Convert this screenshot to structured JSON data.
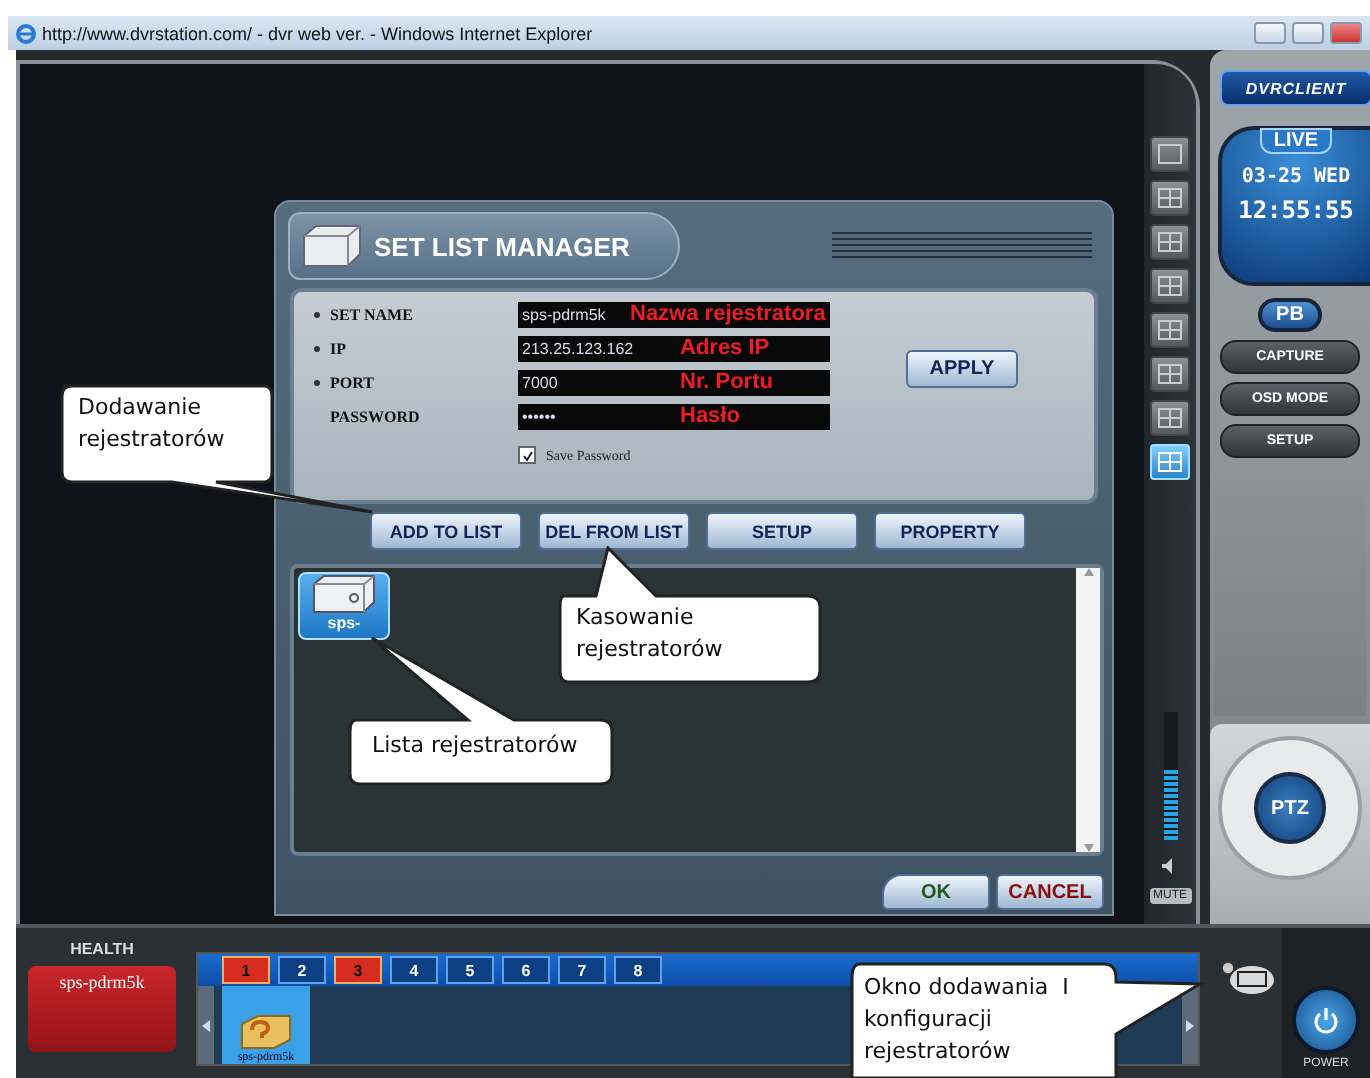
{
  "window": {
    "title": "http://www.dvrstation.com/ - dvr web ver. - Windows Internet Explorer"
  },
  "dialog": {
    "title": "SET LIST MANAGER",
    "fields": [
      {
        "label": "SET NAME",
        "required": true,
        "value": "sps-pdrm5k",
        "note": "Nazwa rejestratora"
      },
      {
        "label": "IP",
        "required": true,
        "value": "213.25.123.162",
        "note": "Adres IP"
      },
      {
        "label": "PORT",
        "required": true,
        "value": "7000",
        "note": "Nr. Portu"
      },
      {
        "label": "PASSWORD",
        "required": false,
        "value": "••••••",
        "note": "Hasło"
      }
    ],
    "save_password": {
      "label": "Save Password",
      "checked": true
    },
    "apply": "APPLY",
    "buttons": [
      "ADD TO LIST",
      "DEL FROM LIST",
      "SETUP",
      "PROPERTY"
    ],
    "list_items": [
      {
        "label": "sps-",
        "selected": true
      }
    ],
    "ok": "OK",
    "cancel": "CANCEL"
  },
  "layout_buttons": [
    {
      "selected": false
    },
    {
      "selected": false
    },
    {
      "selected": false
    },
    {
      "selected": false
    },
    {
      "selected": false
    },
    {
      "selected": false
    },
    {
      "selected": false
    },
    {
      "selected": true
    }
  ],
  "volume": {
    "level": 0.55,
    "mute": "MUTE"
  },
  "panel": {
    "brand": "DVRCLIENT",
    "mode": "LIVE",
    "date": "03-25 WED",
    "time": "12:55:55",
    "pb": "PB",
    "buttons": [
      "CAPTURE",
      "OSD MODE",
      "SETUP"
    ],
    "ptz": "PTZ"
  },
  "bottom": {
    "health_label": "HEALTH",
    "health_name": "sps-pdrm5k",
    "channels": [
      {
        "label": "1",
        "alarm": true
      },
      {
        "label": "2",
        "alarm": false
      },
      {
        "label": "3",
        "alarm": true
      },
      {
        "label": "4",
        "alarm": false
      },
      {
        "label": "5",
        "alarm": false
      },
      {
        "label": "6",
        "alarm": false
      },
      {
        "label": "7",
        "alarm": false
      },
      {
        "label": "8",
        "alarm": false
      }
    ],
    "devices": [
      {
        "label": "sps-pdrm5k",
        "selected": true
      }
    ],
    "power": "POWER"
  },
  "callouts": [
    "Dodawanie rejestratorów",
    "Kasowanie rejestratorów",
    "Lista rejestratorów",
    "Okno dodawania  I konfiguracji rejestratorów"
  ]
}
